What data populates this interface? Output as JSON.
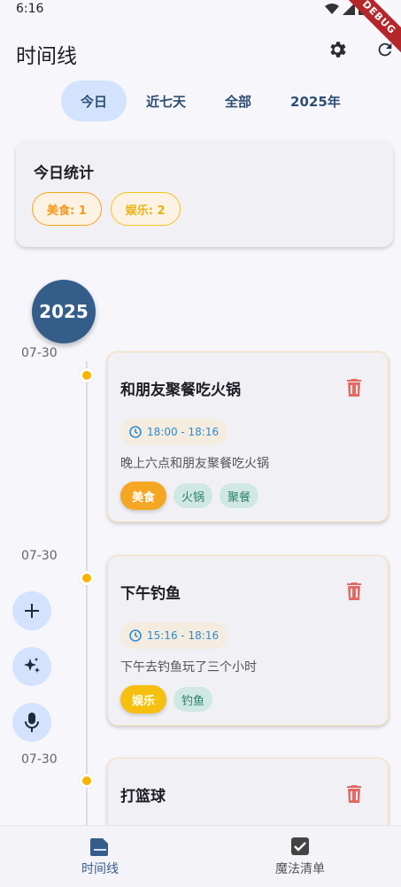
{
  "status_bar": {
    "time": "6:16",
    "debug_label": "DEBUG"
  },
  "app_bar": {
    "title": "时间线",
    "settings_icon": "gear-icon",
    "refresh_icon": "refresh-icon"
  },
  "tabs": [
    {
      "label": "今日",
      "active": true
    },
    {
      "label": "近七天",
      "active": false
    },
    {
      "label": "全部",
      "active": false
    },
    {
      "label": "2025年",
      "active": false
    }
  ],
  "stats": {
    "title": "今日统计",
    "chips": [
      {
        "label": "美食: 1",
        "color": "#f5a623"
      },
      {
        "label": "娱乐: 2",
        "color": "#f5c518"
      }
    ]
  },
  "timeline": {
    "year": "2025",
    "entries": [
      {
        "date": "07-30",
        "title": "和朋友聚餐吃火锅",
        "time_range": "18:00 - 18:16",
        "description": "晚上六点和朋友聚餐吃火锅",
        "category": "美食",
        "tags": [
          "火锅",
          "聚餐"
        ]
      },
      {
        "date": "07-30",
        "title": "下午钓鱼",
        "time_range": "15:16 - 18:16",
        "description": "下午去钓鱼玩了三个小时",
        "category": "娱乐",
        "tags": [
          "钓鱼"
        ]
      },
      {
        "date": "07-30",
        "title": "打篮球",
        "time_range": "",
        "description": "",
        "category": "",
        "tags": []
      }
    ]
  },
  "fabs": [
    {
      "icon": "plus-icon"
    },
    {
      "icon": "sparkle-icon"
    },
    {
      "icon": "microphone-icon"
    }
  ],
  "bottom_nav": [
    {
      "label": "时间线",
      "icon": "timeline-book-icon",
      "active": true
    },
    {
      "label": "魔法清单",
      "icon": "checkbox-icon",
      "active": false
    }
  ],
  "colors": {
    "accent": "#345d8a",
    "food": "#f5a623",
    "entertainment": "#f5c00f",
    "tab_active_bg": "#d3e3fd"
  }
}
